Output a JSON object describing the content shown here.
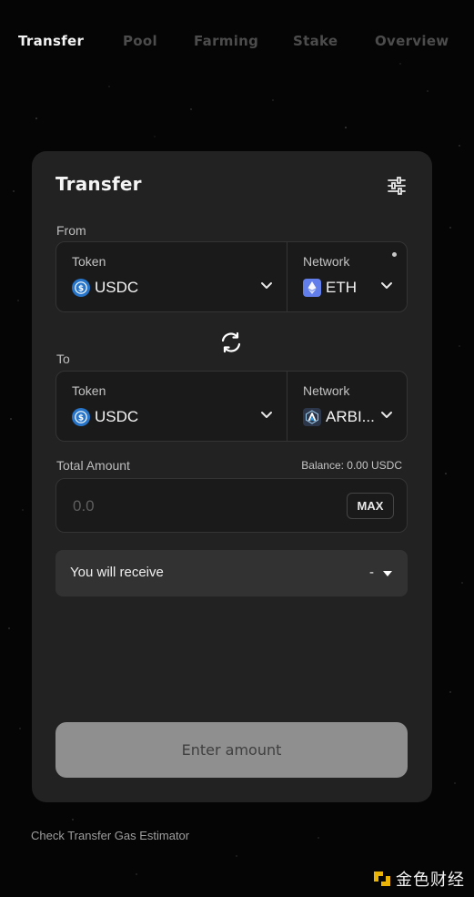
{
  "nav": {
    "items": [
      "Transfer",
      "Pool",
      "Farming",
      "Stake",
      "Overview"
    ],
    "active": "Transfer"
  },
  "card": {
    "title": "Transfer",
    "from": {
      "label": "From",
      "token_caption": "Token",
      "token_value": "USDC",
      "token_icon": "usdc-coin-icon",
      "network_caption": "Network",
      "network_value": "ETH",
      "network_icon": "ethereum-icon"
    },
    "to": {
      "label": "To",
      "token_caption": "Token",
      "token_value": "USDC",
      "token_icon": "usdc-coin-icon",
      "network_caption": "Network",
      "network_value": "ARBI...",
      "network_icon": "arbitrum-icon"
    },
    "amount": {
      "label": "Total Amount",
      "balance": "Balance: 0.00 USDC",
      "placeholder": "0.0",
      "max_label": "MAX"
    },
    "receive": {
      "label": "You will receive",
      "value": "-"
    },
    "submit_label": "Enter amount"
  },
  "footer": {
    "gas_link": "Check Transfer Gas Estimator"
  },
  "watermark": {
    "text": "金色财经"
  },
  "colors": {
    "background": "#050505",
    "card": "#222223",
    "field": "#1a1a1b",
    "button_disabled": "#8f8f8f",
    "usdc_blue": "#2775ca",
    "eth_purple": "#627eea",
    "watermark_gold": "#e9b308"
  }
}
